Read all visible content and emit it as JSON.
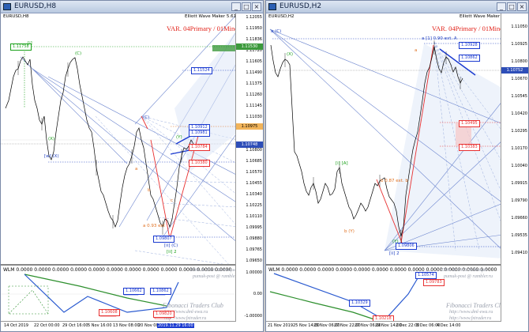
{
  "left": {
    "title": "EURUSD,H8",
    "symbol_line": "EURUSD,H8",
    "ewm": "Elliott Wave Maker 5.61.5",
    "variant": "VAR. 04Primary / 01Minor",
    "indicator": "WLM 0.0000 0.0000 0.0000 0.0000 0.0000 0.0000 0.0000 0.0000 0.0000 0.0000 0.0000 0.0000",
    "watermark1": "DML & EWA Technique",
    "watermark2": "pumuk-post @ rambler.ru",
    "wm_big1": "Fibonacci  Traders  Club",
    "wm_big2": "http://www.dml-ewa.ru",
    "wm_big3": "http://www.fxtrader.ru",
    "prices": [
      "1.12055",
      "1.11950",
      "1.11836",
      "1.11720",
      "1.11605",
      "1.11490",
      "1.11375",
      "1.11260",
      "1.11145",
      "1.11030",
      "1.10915",
      "1.10800",
      "1.10685",
      "1.10570",
      "1.10455",
      "1.10340",
      "1.10225",
      "1.10110",
      "1.09995",
      "1.09880",
      "1.09765",
      "1.09650"
    ],
    "ind_scale": [
      "1.00000",
      "0.00",
      "-1.00000"
    ],
    "dates": [
      "14 Oct 2019",
      "22 Oct 00:00",
      "29 Oct 16:00",
      "5 Nov 16:00",
      "13 Nov 08:00",
      "20 Nov 08:00",
      "2019.11.29 16:00"
    ],
    "tags": {
      "green": "1.11530",
      "orange": "1.10975",
      "blue": "1.10748"
    },
    "boxes": [
      "1.11758",
      "1.11524",
      "1.10912",
      "1.10981",
      "1.10784",
      "1.10380",
      "1.09807",
      "1.10662",
      "1.10608",
      "1.10862",
      "1.09820"
    ],
    "wave_labels": [
      "[i]",
      "(C)",
      "(X)",
      "[w] (X)",
      "(C)",
      "a",
      "b",
      "c",
      "(Y)",
      "a 0.93 ext",
      "[ii] (C)",
      "[ii] 2"
    ]
  },
  "right": {
    "title": "EURUSD,H2",
    "symbol_line": "EURUSD,H2",
    "ewm": "Elliott Wave Maker 5.61.5",
    "variant": "VAR. 04Primary / 01Minor",
    "indicator": "WLM 0.0000 0.0000 0.0000 0.0000 0.0000 0.0000 0.0000 0.0000 0.0000 0.0000 0.0000 0.0000",
    "watermark1": "DML & EWA Technique",
    "watermark2": "pumuk-post @ rambler.ru",
    "wm_big1": "Fibonacci  Traders  Club",
    "wm_big2": "http://www.dml-ewa.ru",
    "wm_big3": "http://www.fxtrader.ru",
    "prices": [
      "1.11050",
      "1.10925",
      "1.10800",
      "1.10670",
      "1.10545",
      "1.10420",
      "1.10295",
      "1.10170",
      "1.10040",
      "1.09915",
      "1.09790",
      "1.09660",
      "1.09535",
      "1.09410"
    ],
    "dates": [
      "21 Nov 2019",
      "25 Nov 14:00",
      "25 Nov 06:00",
      "27 Nov 22:00",
      "27 Nov 06:00",
      "29 Nov 14:00",
      "2 Dec 22:00",
      "3 Dec 06:00",
      "4 Dec 14:00"
    ],
    "tags": {
      "blue": "1.10752"
    },
    "boxes": [
      "1.10928",
      "1.10862",
      "1.10495",
      "1.10383",
      "1.09806",
      "1.10574",
      "1.09783",
      "1.10329",
      "1.10218"
    ],
    "wave_labels": [
      "a (C)",
      "b 0.87 ext. b",
      "[i] [A]",
      "[ii] 2",
      "(X)",
      "(Y)",
      "a [1] 0.90 ext. A",
      "b (Y)",
      "a"
    ]
  }
}
